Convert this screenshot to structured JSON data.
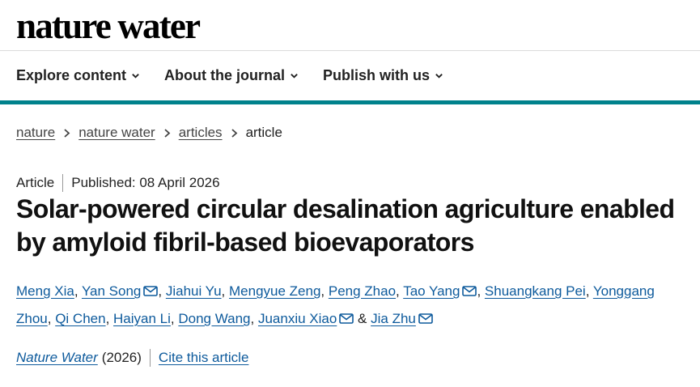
{
  "header": {
    "logo_text": "nature water"
  },
  "nav": {
    "items": [
      {
        "label": "Explore content"
      },
      {
        "label": "About the journal"
      },
      {
        "label": "Publish with us"
      }
    ]
  },
  "breadcrumb": {
    "items": [
      "nature",
      "nature water",
      "articles"
    ],
    "current": "article"
  },
  "article": {
    "type": "Article",
    "published": "Published: 08 April 2026",
    "title": "Solar-powered circular desalination agriculture enabled by amyloid fibril-based bioevaporators",
    "authors": [
      {
        "name": "Meng Xia",
        "sep": ", "
      },
      {
        "name": "Yan Song",
        "sep": ", "
      },
      {
        "name": "Jiahui Yu",
        "sep": ", "
      },
      {
        "name": "Mengyue Zeng",
        "sep": ", "
      },
      {
        "name": "Peng Zhao",
        "sep": ", "
      },
      {
        "name": "Tao Yang",
        "sep": ", "
      },
      {
        "name": "Shuangkang Pei",
        "sep": ", "
      },
      {
        "name": "Yonggang Zhou",
        "sep": ", "
      },
      {
        "name": "Qi Chen",
        "sep": ", "
      },
      {
        "name": "Haiyan Li",
        "sep": ", "
      },
      {
        "name": "Dong Wang",
        "sep": ", "
      },
      {
        "name": "Juanxiu Xiao",
        "sep": " & "
      },
      {
        "name": "Jia Zhu",
        "sep": ""
      }
    ],
    "corresponding_author_icon": "mail-icon",
    "journal": "Nature Water",
    "year": "(2026)",
    "cite_label": "Cite this article"
  },
  "colors": {
    "accent_bar": "#00828c",
    "link": "#0d5a9c"
  }
}
